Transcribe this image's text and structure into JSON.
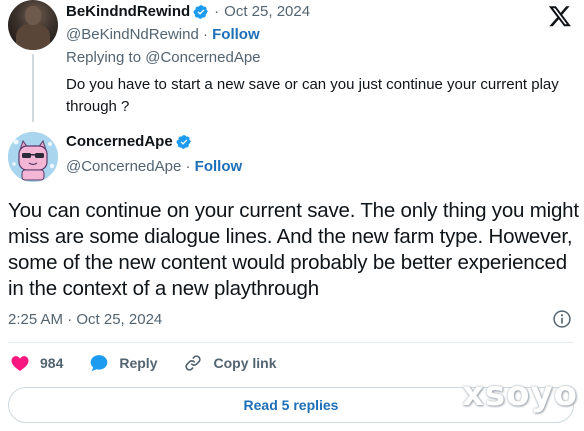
{
  "parent": {
    "name": "BeKindndRewind",
    "date": "Oct 25, 2024",
    "handle": "@BeKindNdRewind",
    "follow_label": "Follow",
    "replying_to": "Replying to @ConcernedApe",
    "text": "Do you have to start a new save or can you just continue your current play through ?"
  },
  "main": {
    "name": "ConcernedApe",
    "handle": "@ConcernedApe",
    "follow_label": "Follow",
    "text": "You can continue on your current save. The only thing you might miss are some dialogue lines. And the new farm type. However, some of the new content would probably be better experienced in the context of a new playthrough",
    "timestamp": "2:25 AM · Oct 25, 2024"
  },
  "actions": {
    "like_count": "984",
    "reply_label": "Reply",
    "copy_link_label": "Copy link"
  },
  "read_replies_label": "Read 5 replies",
  "watermark": "xsoyo",
  "icons": {
    "brand": "x-logo-icon",
    "verified": "verified-badge-icon",
    "info": "info-icon",
    "like": "heart-icon",
    "reply": "speech-bubble-icon",
    "copy_link": "link-icon"
  },
  "colors": {
    "verified_blue": "#1d9bf0",
    "link_blue": "#1d6fb8",
    "like_pink": "#f91880",
    "secondary_text": "#536471"
  }
}
